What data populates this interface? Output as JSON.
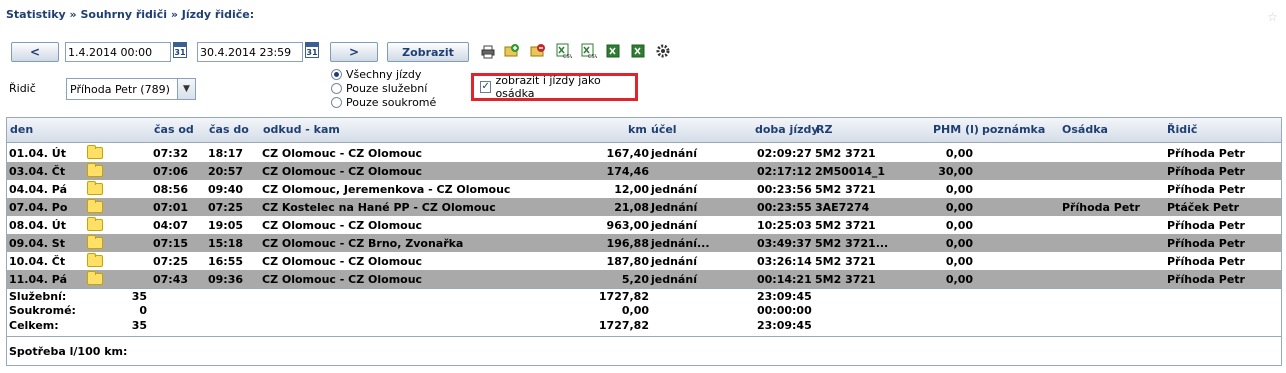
{
  "breadcrumb": "Statistiky » Souhrny řidiči » Jízdy řidiče:",
  "toolbar": {
    "prev_label": "<",
    "next_label": ">",
    "from_date": "1.4.2014 00:00",
    "to_date": "30.4.2014 23:59",
    "calendar_label": "31",
    "show_label": "Zobrazit",
    "icons": [
      "print-icon",
      "add-icon",
      "remove-icon",
      "export-csv-icon",
      "export-csv-icon",
      "export-excel-icon",
      "export-excel-icon",
      "settings-icon"
    ]
  },
  "filter": {
    "driver_label": "Řidič",
    "driver_value": "Příhoda Petr (789)",
    "radios": [
      "Všechny jízdy",
      "Pouze služební",
      "Pouze soukromé"
    ],
    "selected_radio": 0,
    "crew_checkbox_label": "zobrazit i jízdy jako osádka",
    "crew_checked": true
  },
  "table": {
    "headers": [
      "den",
      "čas od",
      "čas do",
      "odkud - kam",
      "km",
      "účel",
      "doba jízdy",
      "RZ",
      "PHM (l)",
      "poznámka",
      "Osádka",
      "Řidič"
    ],
    "rows": [
      [
        "01.04. Út",
        "07:32",
        "18:17",
        "CZ Olomouc - CZ Olomouc",
        "167,40",
        "jednání",
        "02:09:27",
        "5M2 3721",
        "0,00",
        "",
        "",
        "Příhoda Petr"
      ],
      [
        "03.04. Čt",
        "07:06",
        "20:57",
        "CZ Olomouc - CZ Olomouc",
        "174,46",
        "",
        "02:17:12",
        "2M50014_1",
        "30,00",
        "",
        "",
        "Příhoda Petr"
      ],
      [
        "04.04. Pá",
        "08:56",
        "09:40",
        "CZ Olomouc, Jeremenkova - CZ Olomouc",
        "12,00",
        "jednání",
        "00:23:56",
        "5M2 3721",
        "0,00",
        "",
        "",
        "Příhoda Petr"
      ],
      [
        "07.04. Po",
        "07:01",
        "07:25",
        "CZ Kostelec na Hané PP - CZ Olomouc",
        "21,08",
        "Jednání",
        "00:23:55",
        "3AE7274",
        "0,00",
        "",
        "Příhoda Petr",
        "Ptáček Petr"
      ],
      [
        "08.04. Út",
        "04:07",
        "19:05",
        "CZ Olomouc - CZ Olomouc",
        "963,00",
        "jednání",
        "10:25:03",
        "5M2 3721",
        "0,00",
        "",
        "",
        "Příhoda Petr"
      ],
      [
        "09.04. St",
        "07:15",
        "15:18",
        "CZ Olomouc - CZ Brno, Zvonařka",
        "196,88",
        "jednání...",
        "03:49:37",
        "5M2 3721...",
        "0,00",
        "",
        "",
        "Příhoda Petr"
      ],
      [
        "10.04. Čt",
        "07:25",
        "16:55",
        "CZ Olomouc - CZ Olomouc",
        "187,80",
        "jednání",
        "03:26:14",
        "5M2 3721",
        "0,00",
        "",
        "",
        "Příhoda Petr"
      ],
      [
        "11.04. Pá",
        "07:43",
        "09:36",
        "CZ Olomouc - CZ Olomouc",
        "5,20",
        "jednání",
        "00:14:21",
        "5M2 3721",
        "0,00",
        "",
        "",
        "Příhoda Petr"
      ]
    ]
  },
  "summary": [
    {
      "label": "Služební:",
      "count": "35",
      "km": "1727,82",
      "time": "23:09:45"
    },
    {
      "label": "Soukromé:",
      "count": "0",
      "km": "0,00",
      "time": "00:00:00"
    },
    {
      "label": "Celkem:",
      "count": "35",
      "km": "1727,82",
      "time": "23:09:45"
    }
  ],
  "consumption_label": "Spotřeba l/100 km:"
}
